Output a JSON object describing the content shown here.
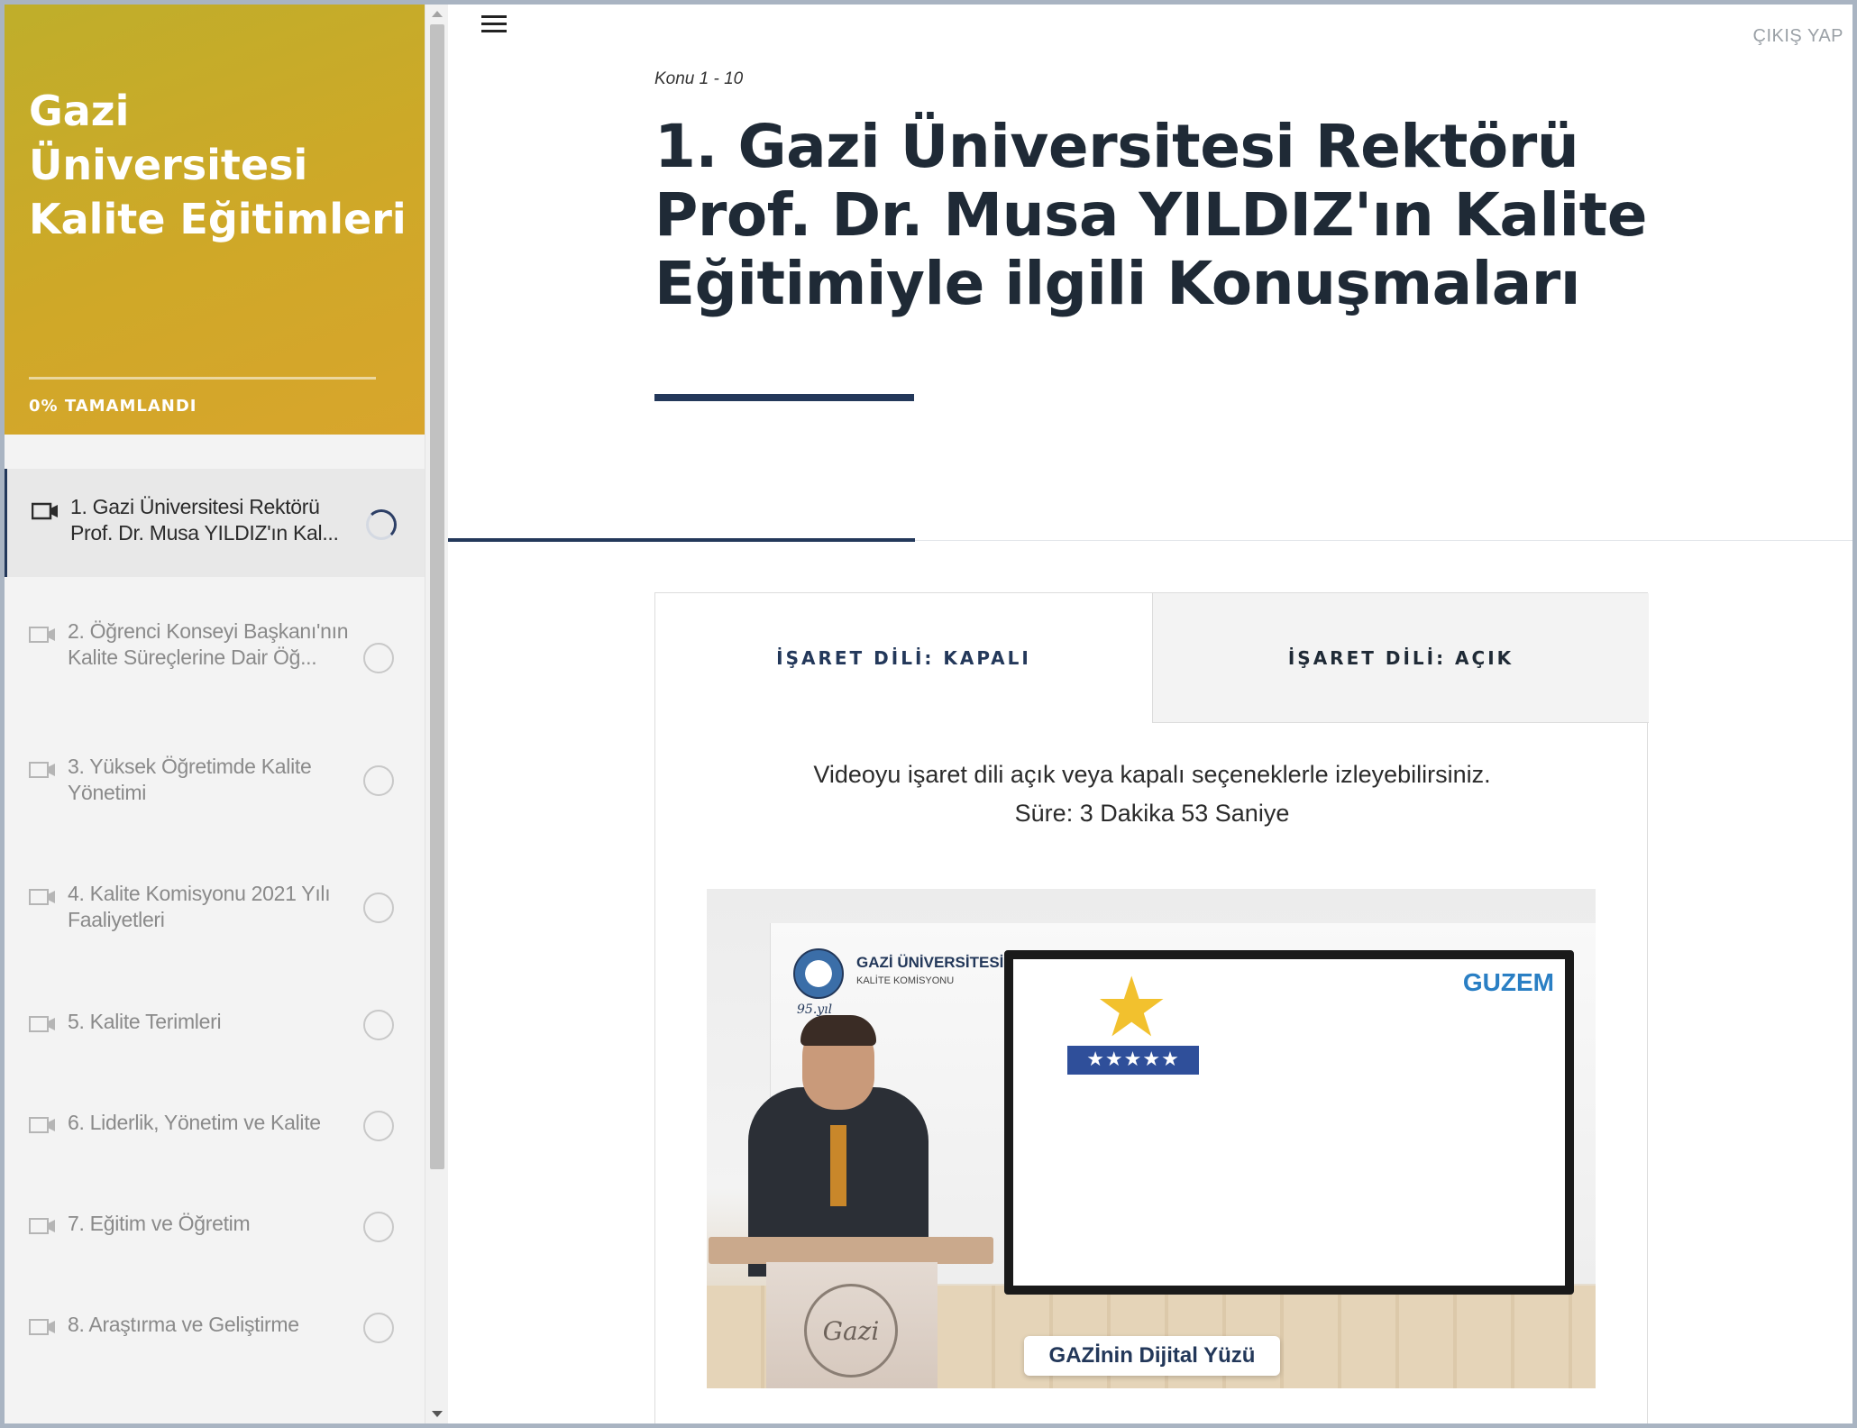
{
  "sidebar": {
    "course_title": "Gazi Üniversitesi Kalite Eğitimleri",
    "progress_label": "0% TAMAMLANDI",
    "progress_percent": 0,
    "lessons": [
      {
        "label": "1. Gazi Üniversitesi Rektörü Prof. Dr. Musa YILDIZ'ın Kal...",
        "status": "in-progress",
        "icon": "video-camera-icon"
      },
      {
        "label": "2. Öğrenci Konseyi Başkanı'nın Kalite Süreçlerine Dair Öğ...",
        "status": "not-started",
        "icon": "video-camera-icon"
      },
      {
        "label": "3. Yüksek Öğretimde Kalite Yönetimi",
        "status": "not-started",
        "icon": "video-camera-icon"
      },
      {
        "label": "4. Kalite Komisyonu 2021 Yılı Faaliyetleri",
        "status": "not-started",
        "icon": "video-camera-icon"
      },
      {
        "label": "5. Kalite Terimleri",
        "status": "not-started",
        "icon": "video-camera-icon"
      },
      {
        "label": "6. Liderlik, Yönetim ve Kalite",
        "status": "not-started",
        "icon": "video-camera-icon"
      },
      {
        "label": "7. Eğitim ve Öğretim",
        "status": "not-started",
        "icon": "video-camera-icon"
      },
      {
        "label": "8. Araştırma ve Geliştirme",
        "status": "not-started",
        "icon": "video-camera-icon"
      }
    ]
  },
  "header": {
    "menu_icon": "hamburger-menu-icon",
    "exit_label": "ÇIKIŞ YAP"
  },
  "lesson": {
    "counter": "Konu 1 - 10",
    "title": "1. Gazi Üniversitesi Rektörü Prof. Dr. Musa YILDIZ'ın Kalite Eğitimiyle ilgili Konuşmaları"
  },
  "tabs": [
    {
      "label": "İŞARET DİLİ: KAPALI",
      "selected": true
    },
    {
      "label": "İŞARET DİLİ: AÇIK",
      "selected": false
    }
  ],
  "content": {
    "description_line1": "Videoyu işaret dili açık veya kapalı seçeneklerle izleyebilirsiniz.",
    "description_line2": "Süre: 3 Dakika 53 Saniye"
  },
  "video": {
    "org_name": "GAZİ ÜNİVERSİTESİ",
    "org_unit": "KALİTE KOMİSYONU",
    "anniversary": "95.yıl",
    "brand": "GUZEM",
    "caption": "GAZİnin Dijital Yüzü",
    "podium_seal": "Gazi"
  },
  "colors": {
    "sidebar_header": "#cfa828",
    "accent_navy": "#23385a",
    "title_text": "#1f2a36"
  }
}
